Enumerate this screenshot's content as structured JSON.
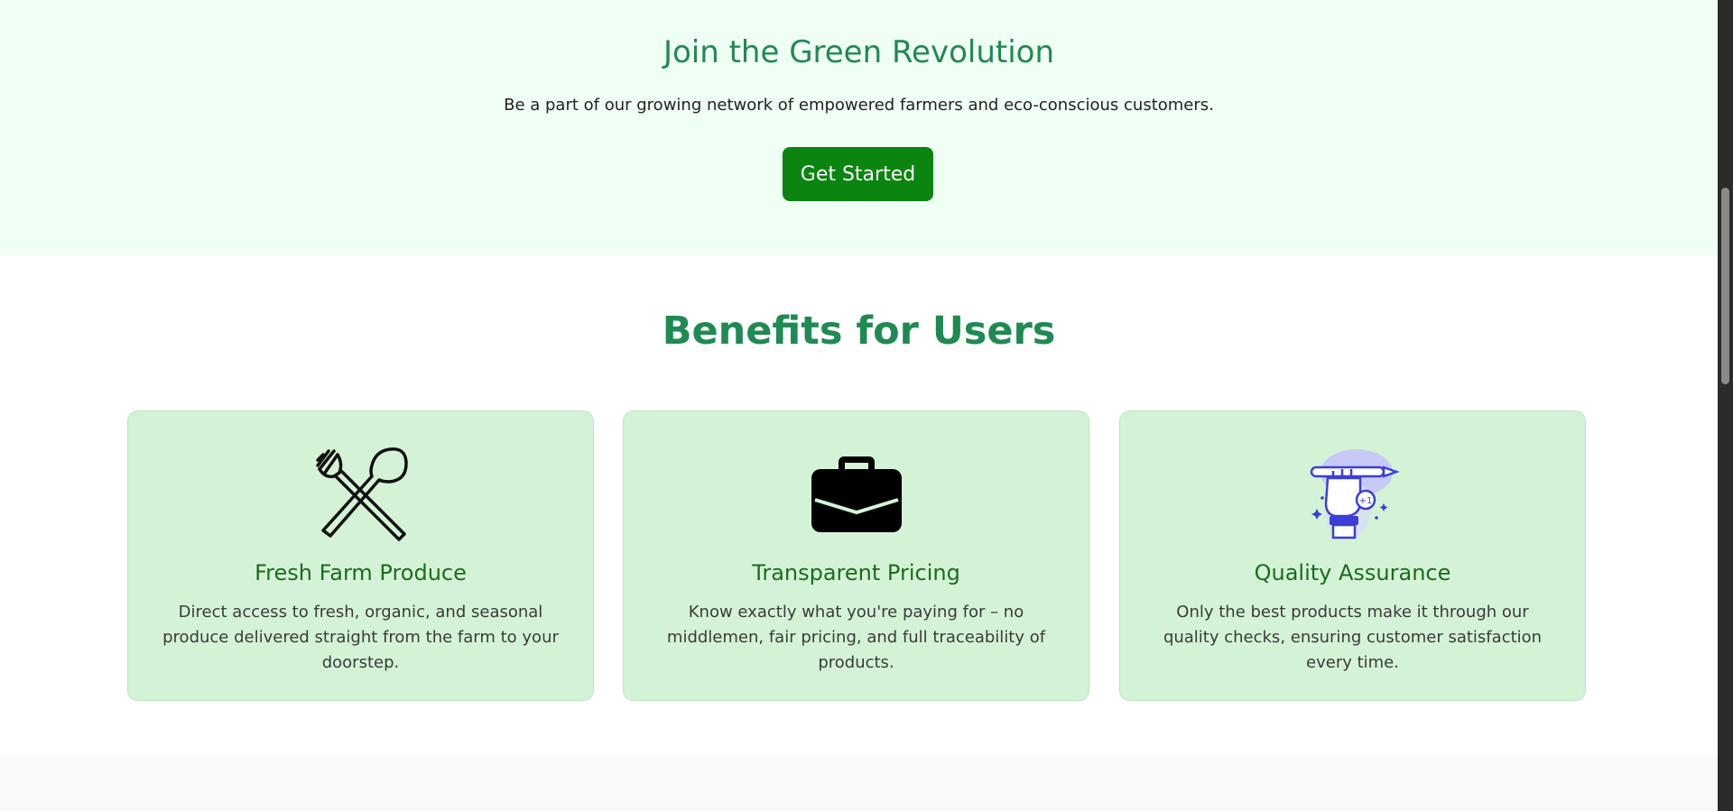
{
  "join": {
    "title": "Join the Green Revolution",
    "subtitle": "Be a part of our growing network of empowered farmers and eco-conscious customers.",
    "cta_label": "Get Started"
  },
  "benefits": {
    "title": "Benefits for Users",
    "cards": [
      {
        "icon": "fork-spoon-icon",
        "title": "Fresh Farm Produce",
        "text": "Direct access to fresh, organic, and seasonal produce delivered straight from the farm to your doorstep."
      },
      {
        "icon": "briefcase-icon",
        "title": "Transparent Pricing",
        "text": "Know exactly what you're paying for – no middlemen, fair pricing, and full traceability of products."
      },
      {
        "icon": "quality-hand-pen-icon",
        "title": "Quality Assurance",
        "text": "Only the best products make it through our quality checks, ensuring customer satisfaction every time."
      }
    ]
  },
  "colors": {
    "accent": "#1f8a52",
    "cta": "#0b8410",
    "card_bg": "#d4f3d6",
    "join_bg": "#f0fff4"
  }
}
